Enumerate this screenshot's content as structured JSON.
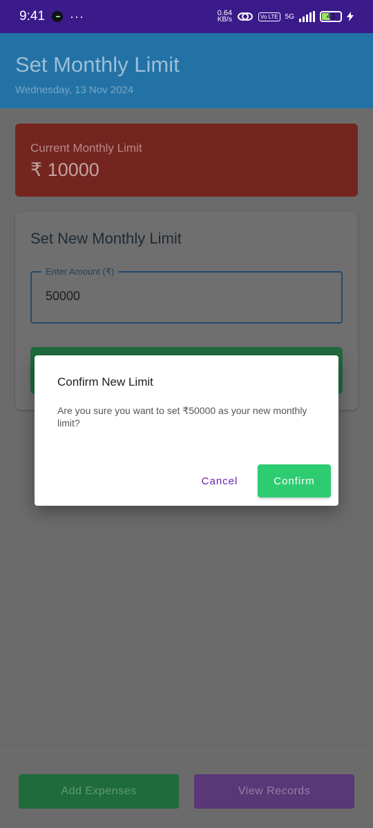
{
  "status_bar": {
    "time": "9:41",
    "more": "···",
    "speed_value": "0.64",
    "speed_unit": "KB/s",
    "volte": "Vo LTE",
    "network": "5G",
    "battery": "43"
  },
  "header": {
    "title": "Set Monthly Limit",
    "date": "Wednesday, 13 Nov 2024"
  },
  "current_limit": {
    "label": "Current Monthly Limit",
    "value": "₹ 10000"
  },
  "new_limit": {
    "title": "Set New Monthly Limit",
    "amount_label": "Enter Amount (₹)",
    "amount_value": "50000"
  },
  "dialog": {
    "title": "Confirm New Limit",
    "message": "Are you sure you want to set ₹50000 as your new monthly limit?",
    "cancel_label": "Cancel",
    "confirm_label": "Confirm"
  },
  "bottom_nav": {
    "add_label": "Add Expenses",
    "view_label": "View Records"
  },
  "colors": {
    "header": "#2980b9",
    "current_card": "#c0392b",
    "confirm": "#2ecc71",
    "add_button": "#27ae60",
    "view_button": "#8e44ad"
  }
}
